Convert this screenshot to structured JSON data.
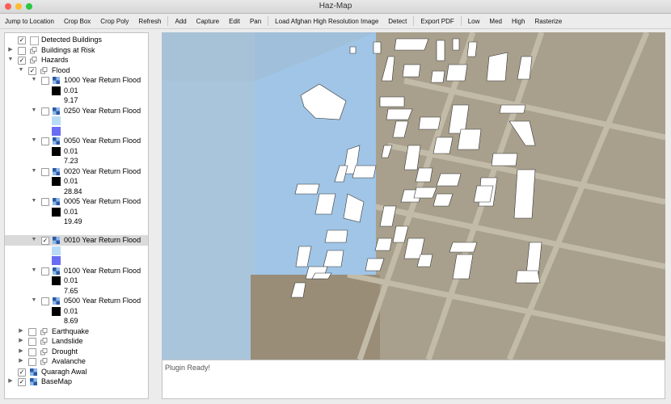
{
  "window": {
    "title": "Haz-Map"
  },
  "toolbar": {
    "group1": [
      "Jump to Location",
      "Crop Box",
      "Crop Poly",
      "Refresh"
    ],
    "group2": [
      "Add",
      "Capture",
      "Edit",
      "Pan"
    ],
    "group3": [
      "Load Afghan High Resolution Image",
      "Detect"
    ],
    "group4": [
      "Export PDF"
    ],
    "group5": [
      "Low",
      "Med",
      "High",
      "Rasterize"
    ]
  },
  "layers": {
    "detected_buildings": "Detected Buildings",
    "buildings_at_risk": "Buildings at Risk",
    "hazards": "Hazards",
    "flood": "Flood",
    "floods": [
      {
        "label": "1000 Year Return Flood",
        "min": "0.01",
        "max": "9.17",
        "checked": false
      },
      {
        "label": "0250 Year Return Flood",
        "min": "",
        "max": "",
        "checked": false
      },
      {
        "label": "0050 Year Return Flood",
        "min": "0.01",
        "max": "7.23",
        "checked": false
      },
      {
        "label": "0020 Year Return Flood",
        "min": "0.01",
        "max": "28.84",
        "checked": false
      },
      {
        "label": "0005 Year Return Flood",
        "min": "0.01",
        "max": "19.49",
        "checked": false
      },
      {
        "label": "0010 Year Return Flood",
        "min": "",
        "max": "",
        "checked": true
      },
      {
        "label": "0100 Year Return Flood",
        "min": "0.01",
        "max": "7.65",
        "checked": false
      },
      {
        "label": "0500 Year Return Flood",
        "min": "0.01",
        "max": "8.69",
        "checked": false
      }
    ],
    "earthquake": "Earthquake",
    "landslide": "Landslide",
    "drought": "Drought",
    "avalanche": "Avalanche",
    "quaragh_awal": "Quaragh Awal",
    "basemap": "BaseMap"
  },
  "status": {
    "text": "Plugin Ready!"
  },
  "colors": {
    "flood_overlay": "#a9cbea",
    "swatch_dark": "#000000",
    "swatch_light": "#b9dcf6",
    "swatch_violet": "#6a6cf3",
    "selection": "#dadada"
  }
}
